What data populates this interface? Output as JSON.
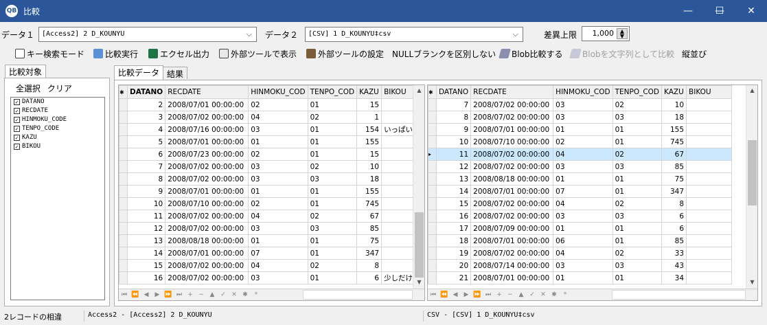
{
  "window": {
    "title": "比較",
    "app_icon_text": "QB",
    "minimize": "—",
    "maximize": "☐",
    "close": "✕"
  },
  "data1": {
    "label": "データ１",
    "value": "[Access2] 2 D_KOUNYU"
  },
  "data2": {
    "label": "データ２",
    "value": "[CSV] 1 D_KOUNYU‡csv"
  },
  "diff_limit": {
    "label": "差異上限",
    "value": "1,000"
  },
  "toolbar": {
    "key_search": "キー検索モード",
    "compare": "比較実行",
    "excel": "エクセル出力",
    "external_show": "外部ツールで表示",
    "external_settings": "外部ツールの設定",
    "null_blank": "NULLブランクを区別しない",
    "blob_compare": "Blob比較する",
    "blob_as_text": "Blobを文字列として比較",
    "sort": "縦並び"
  },
  "left": {
    "tab": "比較対象",
    "select_all": "全選択",
    "clear": "クリア",
    "columns": [
      "DATANO",
      "RECDATE",
      "HINMOKU_CODE",
      "TENPO_CODE",
      "KAZU",
      "BIKOU"
    ]
  },
  "tabs": [
    "比較データ",
    "結果"
  ],
  "grid_left": {
    "headers": [
      "DATANO",
      "RECDATE",
      "HINMOKU_COD",
      "TENPO_COD",
      "KAZU",
      "BIKOU"
    ],
    "rows": [
      [
        "2",
        "2008/07/01 00:00:00",
        "02",
        "01",
        "15",
        ""
      ],
      [
        "3",
        "2008/07/02 00:00:00",
        "04",
        "02",
        "1",
        ""
      ],
      [
        "4",
        "2008/07/16 00:00:00",
        "03",
        "01",
        "154",
        "いっぱい売"
      ],
      [
        "5",
        "2008/07/01 00:00:00",
        "01",
        "01",
        "155",
        ""
      ],
      [
        "6",
        "2008/07/23 00:00:00",
        "02",
        "01",
        "15",
        ""
      ],
      [
        "7",
        "2008/07/02 00:00:00",
        "03",
        "02",
        "10",
        ""
      ],
      [
        "8",
        "2008/07/02 00:00:00",
        "03",
        "03",
        "18",
        ""
      ],
      [
        "9",
        "2008/07/01 00:00:00",
        "01",
        "01",
        "155",
        ""
      ],
      [
        "10",
        "2008/07/10 00:00:00",
        "02",
        "01",
        "745",
        ""
      ],
      [
        "11",
        "2008/07/02 00:00:00",
        "04",
        "02",
        "67",
        ""
      ],
      [
        "12",
        "2008/07/02 00:00:00",
        "03",
        "03",
        "85",
        ""
      ],
      [
        "13",
        "2008/08/18 00:00:00",
        "01",
        "01",
        "75",
        ""
      ],
      [
        "14",
        "2008/07/01 00:00:00",
        "07",
        "01",
        "347",
        ""
      ],
      [
        "15",
        "2008/07/02 00:00:00",
        "04",
        "02",
        "8",
        ""
      ],
      [
        "16",
        "2008/07/02 00:00:00",
        "03",
        "01",
        "6",
        "少しだけ"
      ]
    ]
  },
  "grid_right": {
    "headers": [
      "DATANO",
      "RECDATE",
      "HINMOKU_COD",
      "TENPO_COD",
      "KAZU",
      "BIKOU"
    ],
    "rows": [
      [
        "7",
        "2008/07/02 00:00:00",
        "03",
        "02",
        "10",
        ""
      ],
      [
        "8",
        "2008/07/02 00:00:00",
        "03",
        "03",
        "18",
        ""
      ],
      [
        "9",
        "2008/07/01 00:00:00",
        "01",
        "01",
        "155",
        ""
      ],
      [
        "10",
        "2008/07/10 00:00:00",
        "02",
        "01",
        "745",
        ""
      ],
      [
        "11",
        "2008/07/02 00:00:00",
        "04",
        "02",
        "67",
        ""
      ],
      [
        "12",
        "2008/07/02 00:00:00",
        "03",
        "03",
        "85",
        ""
      ],
      [
        "13",
        "2008/08/18 00:00:00",
        "01",
        "01",
        "75",
        ""
      ],
      [
        "14",
        "2008/07/01 00:00:00",
        "07",
        "01",
        "347",
        ""
      ],
      [
        "15",
        "2008/07/02 00:00:00",
        "04",
        "02",
        "8",
        ""
      ],
      [
        "16",
        "2008/07/02 00:00:00",
        "03",
        "03",
        "6",
        ""
      ],
      [
        "17",
        "2008/07/09 00:00:00",
        "01",
        "01",
        "6",
        ""
      ],
      [
        "18",
        "2008/07/01 00:00:00",
        "06",
        "01",
        "85",
        ""
      ],
      [
        "19",
        "2008/07/02 00:00:00",
        "04",
        "02",
        "33",
        ""
      ],
      [
        "20",
        "2008/07/14 00:00:00",
        "03",
        "03",
        "43",
        ""
      ],
      [
        "21",
        "2008/07/01 00:00:00",
        "01",
        "01",
        "34",
        ""
      ]
    ],
    "selected_row": 4
  },
  "status": {
    "diff": "2レコードの相違",
    "left_src": "Access2 - [Access2] 2 D_KOUNYU",
    "right_src": "CSV - [CSV] 1 D_KOUNYU‡csv"
  },
  "colors": {
    "titlebar": "#2b579a",
    "selection": "#cce8ff"
  }
}
